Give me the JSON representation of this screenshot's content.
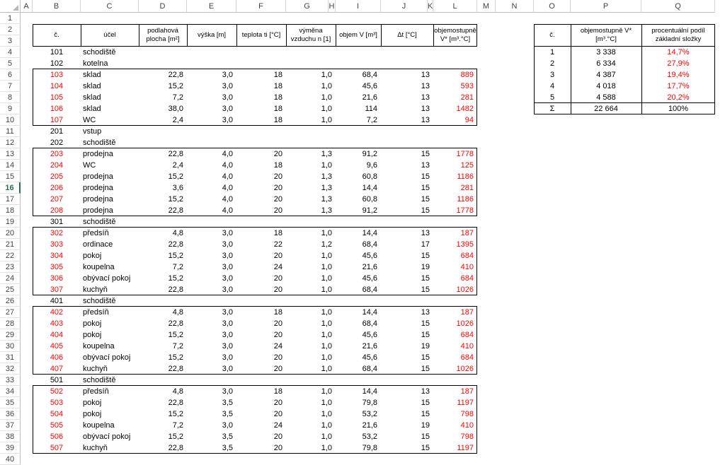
{
  "sheet": {
    "column_headers": [
      "A",
      "B",
      "C",
      "D",
      "E",
      "F",
      "G",
      "H",
      "I",
      "J",
      "K",
      "L",
      "M",
      "N",
      "O",
      "P",
      "Q"
    ],
    "row_numbers": [
      "1",
      "2",
      "3",
      "4",
      "5",
      "6",
      "7",
      "8",
      "9",
      "10",
      "11",
      "12",
      "13",
      "14",
      "15",
      "16",
      "17",
      "18",
      "19",
      "20",
      "21",
      "22",
      "23",
      "24",
      "25",
      "26",
      "27",
      "28",
      "29",
      "30",
      "31",
      "32",
      "33",
      "34",
      "35",
      "36",
      "37",
      "38",
      "39",
      "40"
    ],
    "selected_row": "16",
    "accent_color": "#217346",
    "red_color": "#ff0000"
  },
  "main_table": {
    "headers": {
      "num": "č.",
      "purpose": "účel",
      "area_l1": "podlahová",
      "area_l2": "plocha [m²]",
      "height": "výška [m]",
      "temp": "teplota ti [°C]",
      "exch_l1": "výměna",
      "exch_l2": "vzduchu n [1]",
      "volume": "objem V [m³]",
      "dt": "Δt [°C]",
      "vd_l1": "objemostupně",
      "vd_l2": "V* [m³.°C]"
    },
    "rows": [
      {
        "num": "101",
        "purpose": "schodiště",
        "area": "",
        "height": "",
        "temp": "",
        "exch": "",
        "volume": "",
        "dt": "",
        "vd": "",
        "red": false
      },
      {
        "num": "102",
        "purpose": "kotelna",
        "area": "",
        "height": "",
        "temp": "",
        "exch": "",
        "volume": "",
        "dt": "",
        "vd": "",
        "red": false
      },
      {
        "num": "103",
        "purpose": "sklad",
        "area": "22,8",
        "height": "3,0",
        "temp": "18",
        "exch": "1,0",
        "volume": "68,4",
        "dt": "13",
        "vd": "889",
        "red": true
      },
      {
        "num": "104",
        "purpose": "sklad",
        "area": "15,2",
        "height": "3,0",
        "temp": "18",
        "exch": "1,0",
        "volume": "45,6",
        "dt": "13",
        "vd": "593",
        "red": true
      },
      {
        "num": "105",
        "purpose": "sklad",
        "area": "7,2",
        "height": "3,0",
        "temp": "18",
        "exch": "1,0",
        "volume": "21,6",
        "dt": "13",
        "vd": "281",
        "red": true
      },
      {
        "num": "106",
        "purpose": "sklad",
        "area": "38,0",
        "height": "3,0",
        "temp": "18",
        "exch": "1,0",
        "volume": "114",
        "dt": "13",
        "vd": "1482",
        "red": true
      },
      {
        "num": "107",
        "purpose": "WC",
        "area": "2,4",
        "height": "3,0",
        "temp": "18",
        "exch": "1,0",
        "volume": "7,2",
        "dt": "13",
        "vd": "94",
        "red": true
      },
      {
        "num": "201",
        "purpose": "vstup",
        "area": "",
        "height": "",
        "temp": "",
        "exch": "",
        "volume": "",
        "dt": "",
        "vd": "",
        "red": false
      },
      {
        "num": "202",
        "purpose": "schodiště",
        "area": "",
        "height": "",
        "temp": "",
        "exch": "",
        "volume": "",
        "dt": "",
        "vd": "",
        "red": false
      },
      {
        "num": "203",
        "purpose": "prodejna",
        "area": "22,8",
        "height": "4,0",
        "temp": "20",
        "exch": "1,3",
        "volume": "91,2",
        "dt": "15",
        "vd": "1778",
        "red": true
      },
      {
        "num": "204",
        "purpose": "WC",
        "area": "2,4",
        "height": "4,0",
        "temp": "18",
        "exch": "1,0",
        "volume": "9,6",
        "dt": "13",
        "vd": "125",
        "red": true
      },
      {
        "num": "205",
        "purpose": "prodejna",
        "area": "15,2",
        "height": "4,0",
        "temp": "20",
        "exch": "1,3",
        "volume": "60,8",
        "dt": "15",
        "vd": "1186",
        "red": true
      },
      {
        "num": "206",
        "purpose": "prodejna",
        "area": "3,6",
        "height": "4,0",
        "temp": "20",
        "exch": "1,3",
        "volume": "14,4",
        "dt": "15",
        "vd": "281",
        "red": true
      },
      {
        "num": "207",
        "purpose": "prodejna",
        "area": "15,2",
        "height": "4,0",
        "temp": "20",
        "exch": "1,3",
        "volume": "60,8",
        "dt": "15",
        "vd": "1186",
        "red": true
      },
      {
        "num": "208",
        "purpose": "prodejna",
        "area": "22,8",
        "height": "4,0",
        "temp": "20",
        "exch": "1,3",
        "volume": "91,2",
        "dt": "15",
        "vd": "1778",
        "red": true
      },
      {
        "num": "301",
        "purpose": "schodiště",
        "area": "",
        "height": "",
        "temp": "",
        "exch": "",
        "volume": "",
        "dt": "",
        "vd": "",
        "red": false
      },
      {
        "num": "302",
        "purpose": "předsíň",
        "area": "4,8",
        "height": "3,0",
        "temp": "18",
        "exch": "1,0",
        "volume": "14,4",
        "dt": "13",
        "vd": "187",
        "red": true
      },
      {
        "num": "303",
        "purpose": "ordinace",
        "area": "22,8",
        "height": "3,0",
        "temp": "22",
        "exch": "1,2",
        "volume": "68,4",
        "dt": "17",
        "vd": "1395",
        "red": true
      },
      {
        "num": "304",
        "purpose": "pokoj",
        "area": "15,2",
        "height": "3,0",
        "temp": "20",
        "exch": "1,0",
        "volume": "45,6",
        "dt": "15",
        "vd": "684",
        "red": true
      },
      {
        "num": "305",
        "purpose": "koupelna",
        "area": "7,2",
        "height": "3,0",
        "temp": "24",
        "exch": "1,0",
        "volume": "21,6",
        "dt": "19",
        "vd": "410",
        "red": true
      },
      {
        "num": "306",
        "purpose": "obývací pokoj",
        "area": "15,2",
        "height": "3,0",
        "temp": "20",
        "exch": "1,0",
        "volume": "45,6",
        "dt": "15",
        "vd": "684",
        "red": true
      },
      {
        "num": "307",
        "purpose": "kuchyň",
        "area": "22,8",
        "height": "3,0",
        "temp": "20",
        "exch": "1,0",
        "volume": "68,4",
        "dt": "15",
        "vd": "1026",
        "red": true
      },
      {
        "num": "401",
        "purpose": "schodiště",
        "area": "",
        "height": "",
        "temp": "",
        "exch": "",
        "volume": "",
        "dt": "",
        "vd": "",
        "red": false
      },
      {
        "num": "402",
        "purpose": "předsíň",
        "area": "4,8",
        "height": "3,0",
        "temp": "18",
        "exch": "1,0",
        "volume": "14,4",
        "dt": "13",
        "vd": "187",
        "red": true
      },
      {
        "num": "403",
        "purpose": "pokoj",
        "area": "22,8",
        "height": "3,0",
        "temp": "20",
        "exch": "1,0",
        "volume": "68,4",
        "dt": "15",
        "vd": "1026",
        "red": true
      },
      {
        "num": "404",
        "purpose": "pokoj",
        "area": "15,2",
        "height": "3,0",
        "temp": "20",
        "exch": "1,0",
        "volume": "45,6",
        "dt": "15",
        "vd": "684",
        "red": true
      },
      {
        "num": "405",
        "purpose": "koupelna",
        "area": "7,2",
        "height": "3,0",
        "temp": "24",
        "exch": "1,0",
        "volume": "21,6",
        "dt": "19",
        "vd": "410",
        "red": true
      },
      {
        "num": "406",
        "purpose": "obývací pokoj",
        "area": "15,2",
        "height": "3,0",
        "temp": "20",
        "exch": "1,0",
        "volume": "45,6",
        "dt": "15",
        "vd": "684",
        "red": true
      },
      {
        "num": "407",
        "purpose": "kuchyň",
        "area": "22,8",
        "height": "3,0",
        "temp": "20",
        "exch": "1,0",
        "volume": "68,4",
        "dt": "15",
        "vd": "1026",
        "red": true
      },
      {
        "num": "501",
        "purpose": "schodiště",
        "area": "",
        "height": "",
        "temp": "",
        "exch": "",
        "volume": "",
        "dt": "",
        "vd": "",
        "red": false
      },
      {
        "num": "502",
        "purpose": "předsíň",
        "area": "4,8",
        "height": "3,0",
        "temp": "18",
        "exch": "1,0",
        "volume": "14,4",
        "dt": "13",
        "vd": "187",
        "red": true
      },
      {
        "num": "503",
        "purpose": "pokoj",
        "area": "22,8",
        "height": "3,5",
        "temp": "20",
        "exch": "1,0",
        "volume": "79,8",
        "dt": "15",
        "vd": "1197",
        "red": true
      },
      {
        "num": "504",
        "purpose": "pokoj",
        "area": "15,2",
        "height": "3,5",
        "temp": "20",
        "exch": "1,0",
        "volume": "53,2",
        "dt": "15",
        "vd": "798",
        "red": true
      },
      {
        "num": "505",
        "purpose": "koupelna",
        "area": "7,2",
        "height": "3,0",
        "temp": "24",
        "exch": "1,0",
        "volume": "21,6",
        "dt": "19",
        "vd": "410",
        "red": true
      },
      {
        "num": "506",
        "purpose": "obývací pokoj",
        "area": "15,2",
        "height": "3,5",
        "temp": "20",
        "exch": "1,0",
        "volume": "53,2",
        "dt": "15",
        "vd": "798",
        "red": true
      },
      {
        "num": "507",
        "purpose": "kuchyň",
        "area": "22,8",
        "height": "3,5",
        "temp": "20",
        "exch": "1,0",
        "volume": "79,8",
        "dt": "15",
        "vd": "1197",
        "red": true
      }
    ]
  },
  "summary_table": {
    "headers": {
      "num": "č.",
      "vd_l1": "objemostupně V*",
      "vd_l2": "[m³.°C]",
      "pct_l1": "procentuální podíl",
      "pct_l2": "základní složky"
    },
    "rows": [
      {
        "num": "1",
        "vd": "3 338",
        "pct": "14,7%"
      },
      {
        "num": "2",
        "vd": "6 334",
        "pct": "27,9%"
      },
      {
        "num": "3",
        "vd": "4 387",
        "pct": "19,4%"
      },
      {
        "num": "4",
        "vd": "4 018",
        "pct": "17,7%"
      },
      {
        "num": "5",
        "vd": "4 588",
        "pct": "20,2%"
      }
    ],
    "total": {
      "num": "Σ",
      "vd": "22 664",
      "pct": "100%"
    }
  }
}
